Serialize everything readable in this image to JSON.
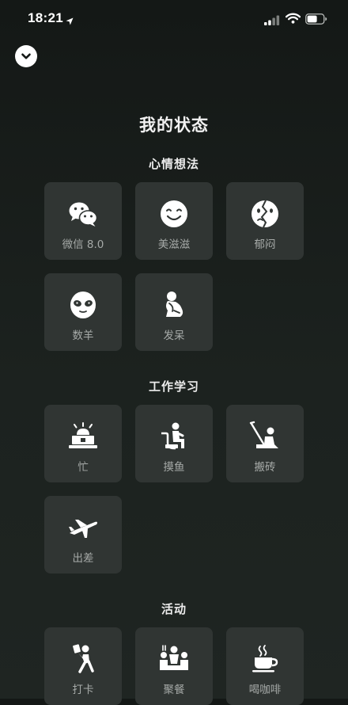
{
  "status_bar": {
    "time": "18:21"
  },
  "header": {
    "title": "我的状态"
  },
  "sections": [
    {
      "title": "心情想法",
      "items": [
        {
          "label": "微信 8.0",
          "icon": "wechat-icon"
        },
        {
          "label": "美滋滋",
          "icon": "smile-face-icon"
        },
        {
          "label": "郁闷",
          "icon": "gloomy-face-icon"
        },
        {
          "label": "数羊",
          "icon": "sheep-face-icon"
        },
        {
          "label": "发呆",
          "icon": "daze-figure-icon"
        }
      ]
    },
    {
      "title": "工作学习",
      "items": [
        {
          "label": "忙",
          "icon": "busy-alarm-laptop-icon"
        },
        {
          "label": "摸鱼",
          "icon": "slacking-toilet-icon"
        },
        {
          "label": "搬砖",
          "icon": "brick-moving-icon"
        },
        {
          "label": "出差",
          "icon": "airplane-icon"
        }
      ]
    },
    {
      "title": "活动",
      "items": [
        {
          "label": "打卡",
          "icon": "check-in-icon"
        },
        {
          "label": "聚餐",
          "icon": "gathering-meal-icon"
        },
        {
          "label": "喝咖啡",
          "icon": "coffee-cup-icon"
        }
      ]
    }
  ]
}
